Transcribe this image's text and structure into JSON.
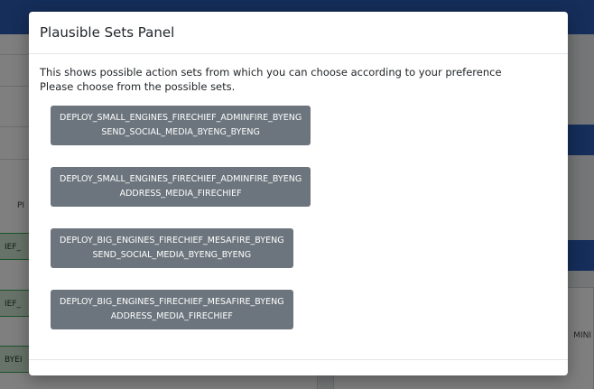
{
  "background": {
    "fragments": [
      "PI",
      "IEF_",
      "IEF_",
      "BYEI",
      "MINI"
    ]
  },
  "modal": {
    "title": "Plausible Sets Panel",
    "description_line1": "This shows possible action sets from which you can choose according to your preference",
    "description_line2": "Please choose from the possible sets.",
    "sets": [
      {
        "line1": "DEPLOY_SMALL_ENGINES_FIRECHIEF_ADMINFIRE_BYENG",
        "line2": "SEND_SOCIAL_MEDIA_BYENG_BYENG"
      },
      {
        "line1": "DEPLOY_SMALL_ENGINES_FIRECHIEF_ADMINFIRE_BYENG",
        "line2": "ADDRESS_MEDIA_FIRECHIEF"
      },
      {
        "line1": "DEPLOY_BIG_ENGINES_FIRECHIEF_MESAFIRE_BYENG",
        "line2": "SEND_SOCIAL_MEDIA_BYENG_BYENG"
      },
      {
        "line1": "DEPLOY_BIG_ENGINES_FIRECHIEF_MESAFIRE_BYENG",
        "line2": "ADDRESS_MEDIA_FIRECHIEF"
      }
    ]
  },
  "colors": {
    "button_bg": "#6c757d",
    "header_blue": "#2a5db4",
    "chip_green": "#34a853"
  }
}
